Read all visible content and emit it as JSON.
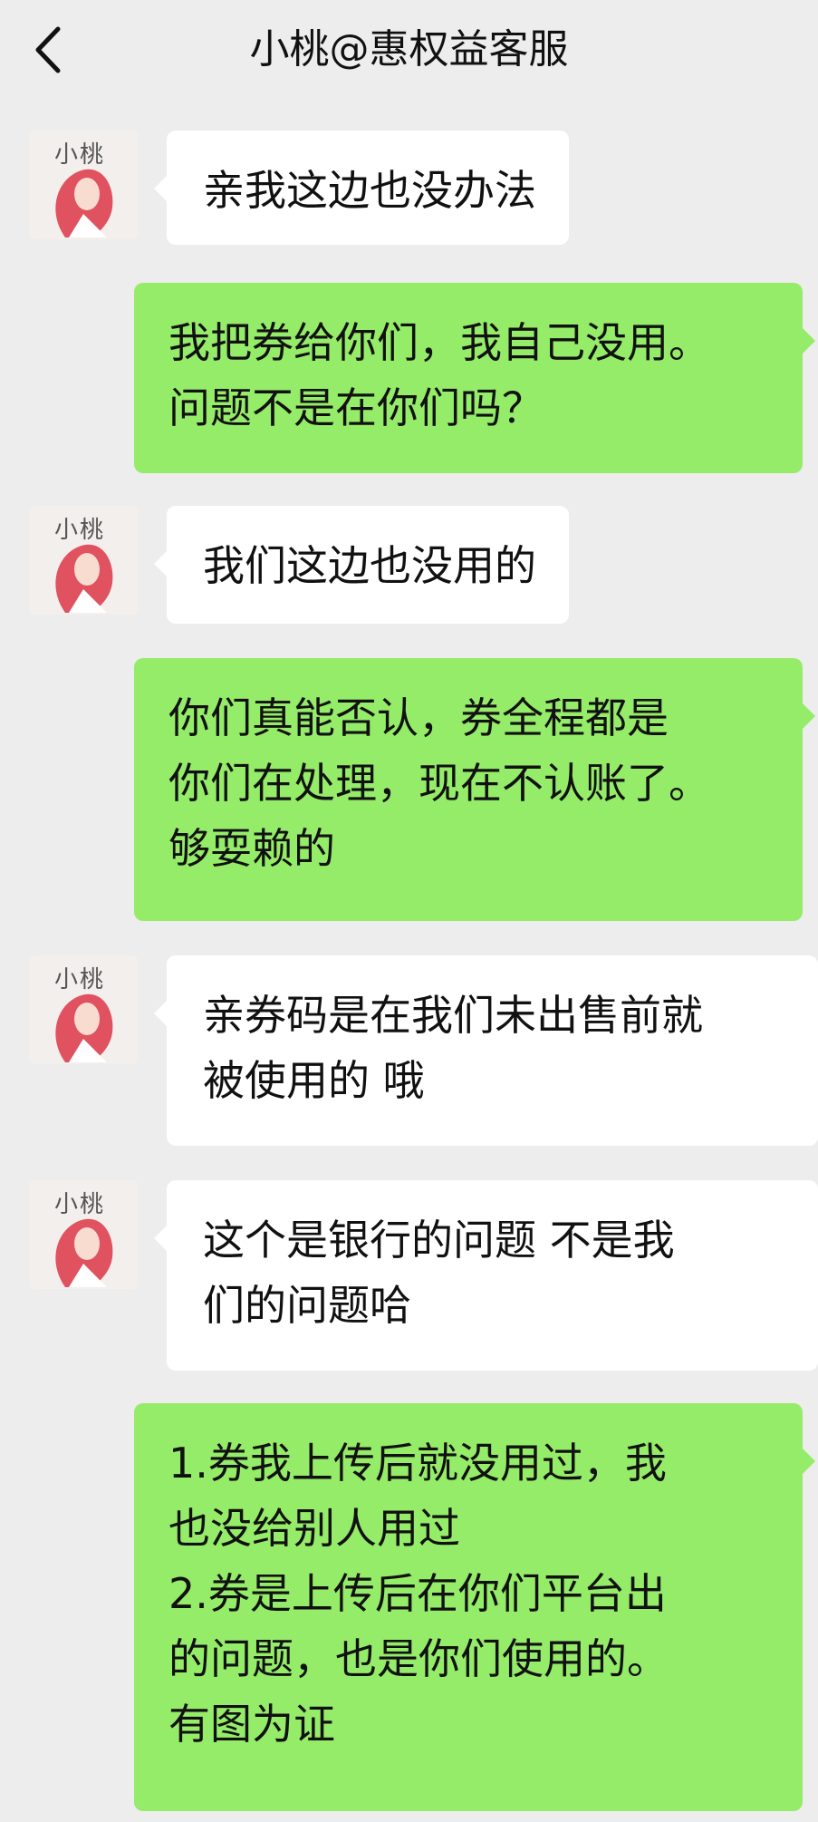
{
  "header": {
    "title": "小桃@惠权益客服",
    "back_icon": "chevron-left-icon"
  },
  "contact": {
    "avatar_text": "小桃"
  },
  "messages": [
    {
      "side": "in",
      "text": "亲我这边也没办法"
    },
    {
      "side": "out",
      "text": "我把券给你们，我自己没用。\n问题不是在你们吗？"
    },
    {
      "side": "in",
      "text": "我们这边也没用的"
    },
    {
      "side": "out",
      "text": "你们真能否认，券全程都是\n你们在处理，现在不认账了。\n够耍赖的"
    },
    {
      "side": "in",
      "text": "亲券码是在我们未出售前就\n被使用的 哦"
    },
    {
      "side": "in",
      "text": "这个是银行的问题 不是我\n们的问题哈"
    },
    {
      "side": "out",
      "text": "1.券我上传后就没用过，我\n也没给别人用过\n2.券是上传后在你们平台出\n的问题，也是你们使用的。\n有图为证"
    }
  ],
  "colors": {
    "background": "#ededed",
    "incoming_bubble": "#ffffff",
    "outgoing_bubble": "#95ec69"
  }
}
